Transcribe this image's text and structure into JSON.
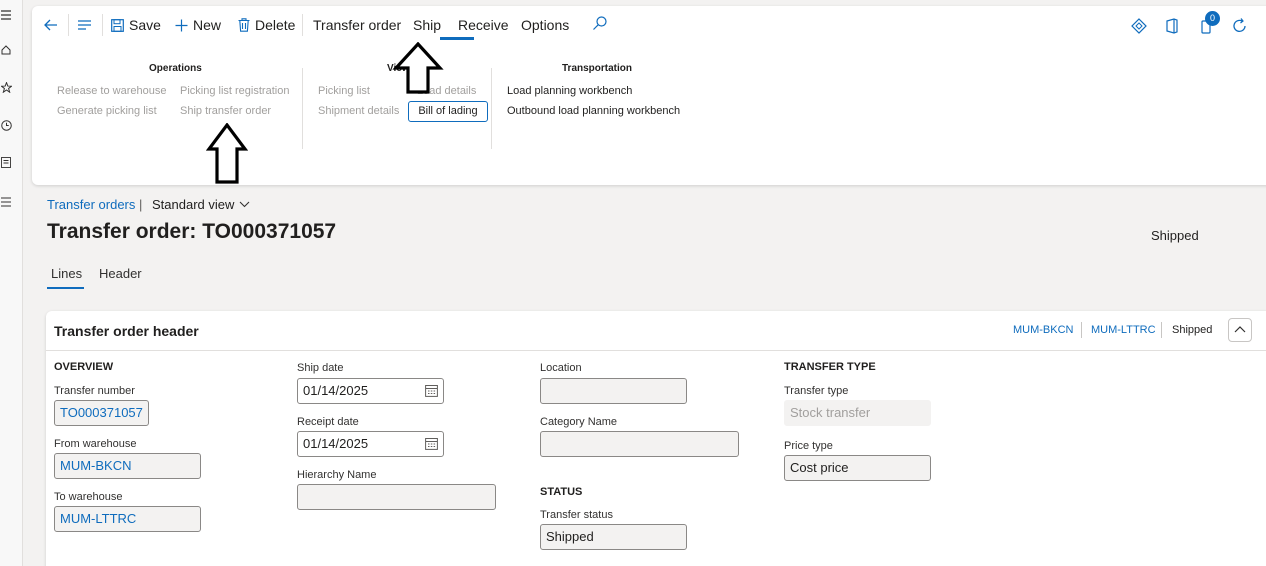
{
  "toolbar": {
    "save": "Save",
    "new": "New",
    "delete": "Delete",
    "tabs": [
      "Transfer order",
      "Ship",
      "Receive",
      "Options"
    ],
    "notification_count": "0"
  },
  "groups": {
    "operations": {
      "title": "Operations",
      "items": [
        "Release to warehouse",
        "Picking list registration",
        "Generate picking list",
        "Ship transfer order"
      ]
    },
    "view": {
      "title": "View",
      "items": [
        "Picking list",
        "Load details",
        "Shipment details",
        "Bill of lading"
      ]
    },
    "transportation": {
      "title": "Transportation",
      "items": [
        "Load planning workbench",
        "Outbound load planning workbench"
      ]
    }
  },
  "breadcrumb": {
    "link": "Transfer orders",
    "sep": "|",
    "view": "Standard view"
  },
  "page": {
    "title": "Transfer order: TO000371057",
    "status": "Shipped",
    "tabs": [
      "Lines",
      "Header"
    ]
  },
  "header_card": {
    "title": "Transfer order header",
    "summary": [
      "MUM-BKCN",
      "MUM-LTTRC",
      "Shipped"
    ],
    "overview": {
      "section": "OVERVIEW",
      "transfer_number_label": "Transfer number",
      "transfer_number": "TO000371057",
      "from_label": "From warehouse",
      "from": "MUM-BKCN",
      "to_label": "To warehouse",
      "to": "MUM-LTTRC"
    },
    "dates": {
      "ship_label": "Ship date",
      "ship": "01/14/2025",
      "receipt_label": "Receipt date",
      "receipt": "01/14/2025",
      "hierarchy_label": "Hierarchy Name",
      "hierarchy": ""
    },
    "location": {
      "location_label": "Location",
      "location": "",
      "category_label": "Category Name",
      "category": "",
      "status_section": "STATUS",
      "transfer_status_label": "Transfer status",
      "transfer_status": "Shipped"
    },
    "transfer_type": {
      "section": "TRANSFER TYPE",
      "type_label": "Transfer type",
      "type": "Stock transfer",
      "price_label": "Price type",
      "price": "Cost price"
    }
  },
  "colors": {
    "accent": "#0f6cbd",
    "disabled_text": "#a19f9d"
  }
}
